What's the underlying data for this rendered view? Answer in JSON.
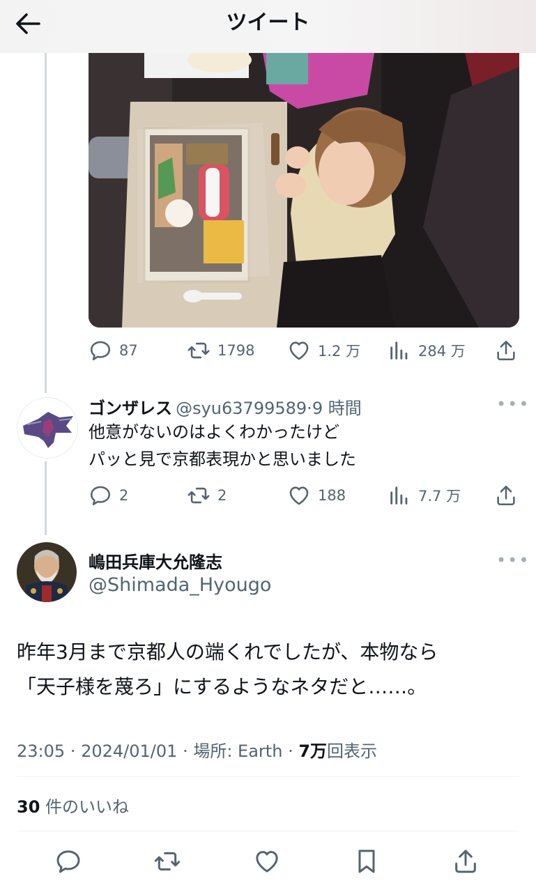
{
  "header": {
    "title": "ツイート",
    "back_icon": "arrow-left-icon"
  },
  "original_tweet": {
    "stats": {
      "replies": "87",
      "retweets": "1798",
      "likes": "1.2 万",
      "views": "284 万"
    }
  },
  "reply": {
    "display_name": "ゴンザレス",
    "handle": "@syu63799589",
    "sep": "·",
    "time": "9 時間",
    "line1": "他意がないのはよくわかったけど",
    "line2": "パッと見で京都表現かと思いました",
    "stats": {
      "replies": "2",
      "retweets": "2",
      "likes": "188",
      "views": "7.7 万"
    }
  },
  "main_tweet": {
    "display_name": "嶋田兵庫大允隆志",
    "handle": "@Shimada_Hyougo",
    "line1": "昨年3月まで京都人の端くれでしたが、本物なら",
    "line2": "「天子様を蔑ろ」にするようなネタだと……。",
    "time": "23:05",
    "date": "2024/01/01",
    "location_label": "場所: Earth",
    "views_count": "7万",
    "views_label": "回表示",
    "dot": "·",
    "likes_count": "30",
    "likes_label": "件のいいね"
  },
  "colors": {
    "muted": "#536471",
    "thread_line": "#cfd9de",
    "divider": "#eff3f4"
  },
  "icons": [
    "arrow-left-icon",
    "reply-icon",
    "retweet-icon",
    "like-icon",
    "views-icon",
    "share-icon",
    "more-icon",
    "bookmark-icon"
  ]
}
